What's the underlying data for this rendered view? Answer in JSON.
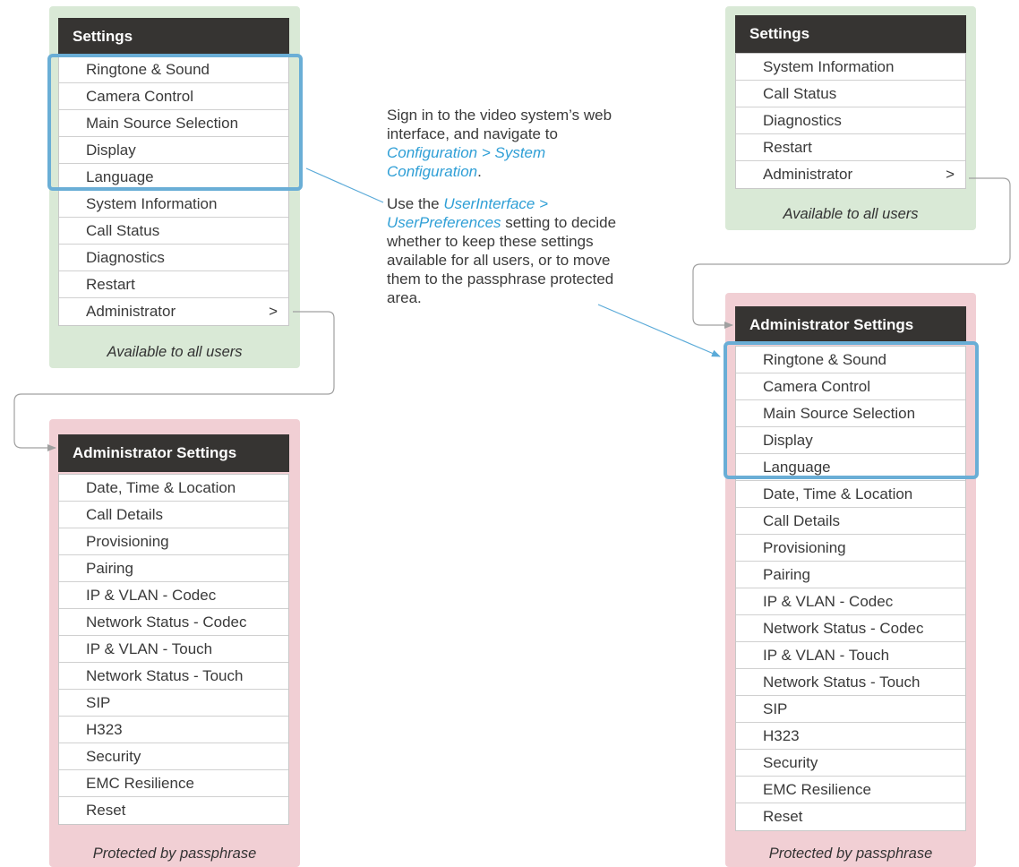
{
  "left": {
    "settings": {
      "title": "Settings",
      "items": [
        "Ringtone & Sound",
        "Camera Control",
        "Main Source Selection",
        "Display",
        "Language",
        "System Information",
        "Call Status",
        "Diagnostics",
        "Restart",
        "Administrator"
      ],
      "arrow": ">",
      "caption": "Available to all users"
    },
    "admin": {
      "title": "Administrator Settings",
      "items": [
        "Date, Time & Location",
        "Call Details",
        "Provisioning",
        "Pairing",
        "IP & VLAN - Codec",
        "Network Status - Codec",
        "IP & VLAN - Touch",
        "Network Status - Touch",
        "SIP",
        "H323",
        "Security",
        "EMC Resilience",
        "Reset"
      ],
      "caption": "Protected by passphrase"
    }
  },
  "right": {
    "settings": {
      "title": "Settings",
      "items": [
        "System Information",
        "Call Status",
        "Diagnostics",
        "Restart",
        "Administrator"
      ],
      "arrow": ">",
      "caption": "Available to all users"
    },
    "admin": {
      "title": "Administrator Settings",
      "items": [
        "Ringtone & Sound",
        "Camera Control",
        "Main Source Selection",
        "Display",
        "Language",
        "Date, Time & Location",
        "Call Details",
        "Provisioning",
        "Pairing",
        "IP & VLAN - Codec",
        "Network Status - Codec",
        "IP & VLAN - Touch",
        "Network Status - Touch",
        "SIP",
        "H323",
        "Security",
        "EMC Resilience",
        "Reset"
      ],
      "caption": "Protected by passphrase"
    }
  },
  "description": {
    "p1_prefix": "Sign in to the video system’s web interface, and navigate to ",
    "p1_link": "Configuration > System Configuration",
    "p1_suffix": ".",
    "p2_prefix": "Use the ",
    "p2_link": "UserInterface > UserPreferences",
    "p2_suffix": " setting to decide whether to keep these settings available for all users, or to move them to the passphrase protected area."
  },
  "colors": {
    "green_bg": "#d9e9d6",
    "pink_bg": "#f1cfd4",
    "header_bg": "#363432",
    "highlight": "#6aaed6",
    "link": "#2f9fd6"
  }
}
